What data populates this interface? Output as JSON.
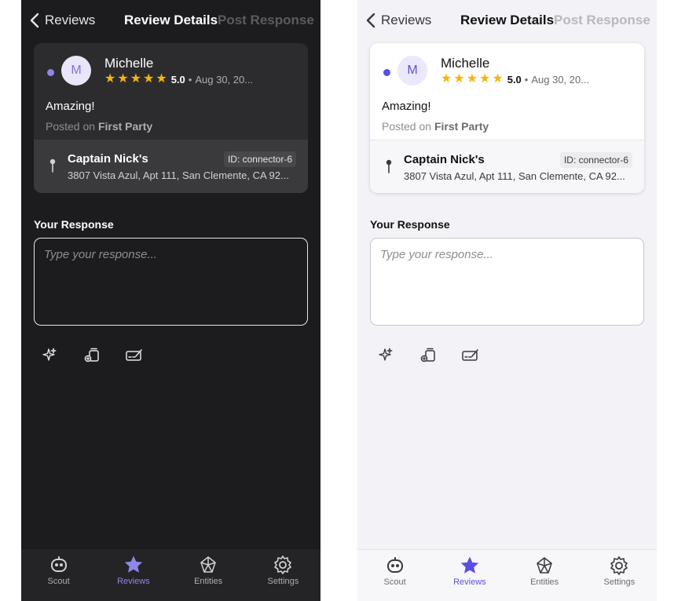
{
  "screens": [
    {
      "theme": "dark",
      "header": {
        "back_label": "Reviews",
        "title": "Review Details",
        "action_label": "Post Response"
      },
      "review": {
        "avatar_initial": "M",
        "reviewer_name": "Michelle",
        "rating": "5.0",
        "separator": "•",
        "date": "Aug 30, 20...",
        "comment": "Amazing!",
        "posted_prefix": "Posted on",
        "platform": "First Party",
        "location": {
          "name": "Captain Nick's",
          "id_badge": "ID: connector-6",
          "address": "3807 Vista Azul, Apt 111, San Clemente, CA 92..."
        }
      },
      "response": {
        "label": "Your Response",
        "placeholder": "Type your response..."
      },
      "tabs": [
        {
          "label": "Scout"
        },
        {
          "label": "Reviews"
        },
        {
          "label": "Entities"
        },
        {
          "label": "Settings"
        }
      ]
    },
    {
      "theme": "light",
      "header": {
        "back_label": "Reviews",
        "title": "Review Details",
        "action_label": "Post Response"
      },
      "review": {
        "avatar_initial": "M",
        "reviewer_name": "Michelle",
        "rating": "5.0",
        "separator": "•",
        "date": "Aug 30, 20...",
        "comment": "Amazing!",
        "posted_prefix": "Posted on",
        "platform": "First Party",
        "location": {
          "name": "Captain Nick's",
          "id_badge": "ID: connector-6",
          "address": "3807 Vista Azul, Apt 111, San Clemente, CA 92..."
        }
      },
      "response": {
        "label": "Your Response",
        "placeholder": "Type your response..."
      },
      "tabs": [
        {
          "label": "Scout"
        },
        {
          "label": "Reviews"
        },
        {
          "label": "Entities"
        },
        {
          "label": "Settings"
        }
      ]
    }
  ],
  "star_count": 5,
  "active_tab": "Reviews",
  "colors": {
    "star": "#f5b50a",
    "accent_light": "#5b4fe0",
    "accent_dark": "#8e86e8",
    "dark_background": "#1c1c1e",
    "light_background": "#f2f2f7"
  },
  "icons": {
    "back": "chevron-left-icon",
    "pin": "pin-icon",
    "tools": [
      "sparkles-icon",
      "add-template-icon",
      "signature-icon"
    ],
    "tabs": [
      "robot-icon",
      "star-icon",
      "network-icon",
      "gear-icon"
    ]
  }
}
